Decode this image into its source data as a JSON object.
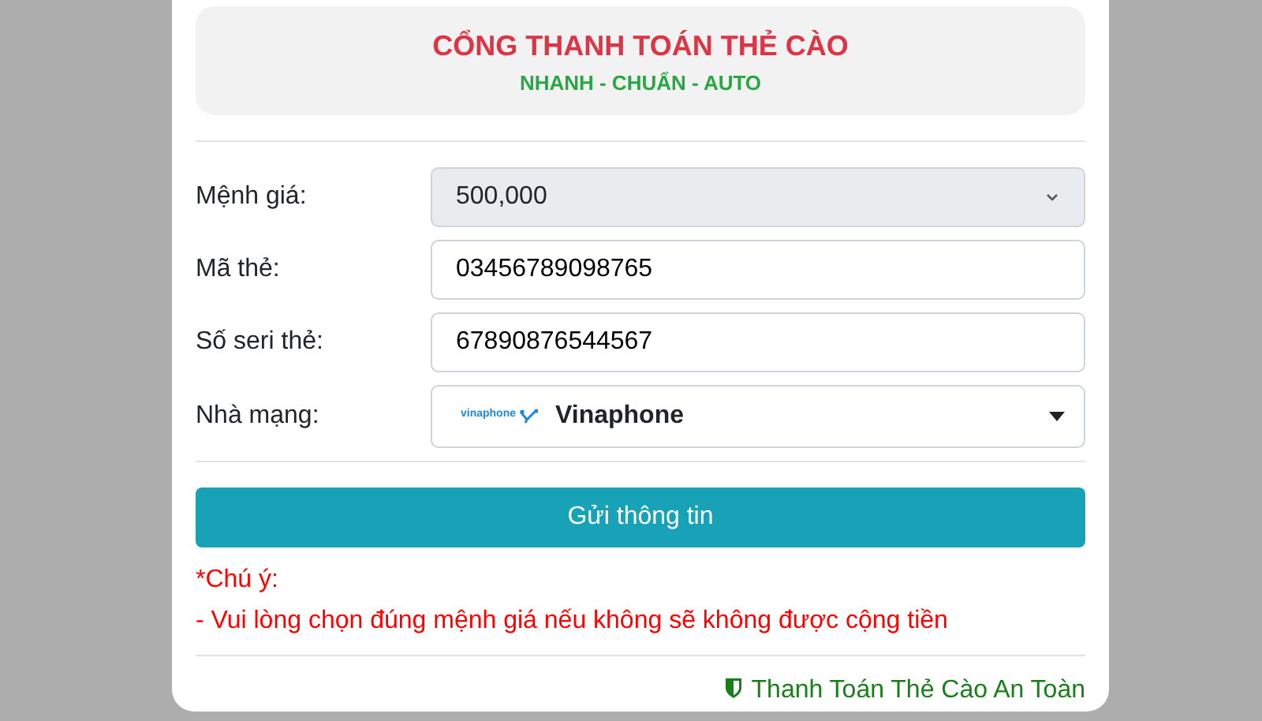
{
  "header": {
    "title": "CỔNG THANH TOÁN THẺ CÀO",
    "subtitle": "NHANH - CHUẨN - AUTO"
  },
  "fields": [
    {
      "kind": "select",
      "label": "Mệnh giá:",
      "value": "500,000",
      "disabled": true
    },
    {
      "kind": "input",
      "label": "Mã thẻ:",
      "value": "03456789098765"
    },
    {
      "kind": "input",
      "label": "Số seri thẻ:",
      "value": "67890876544567"
    },
    {
      "kind": "network",
      "label": "Nhà mạng:",
      "value": "Vinaphone",
      "logo_text": "vinaphone"
    }
  ],
  "submit": "Gửi thông tin",
  "notes": [
    "*Chú ý:",
    "- Vui lòng chọn đúng mệnh giá nếu không sẽ không được cộng tiền"
  ],
  "footer": "Thanh Toán Thẻ Cào An Toàn"
}
